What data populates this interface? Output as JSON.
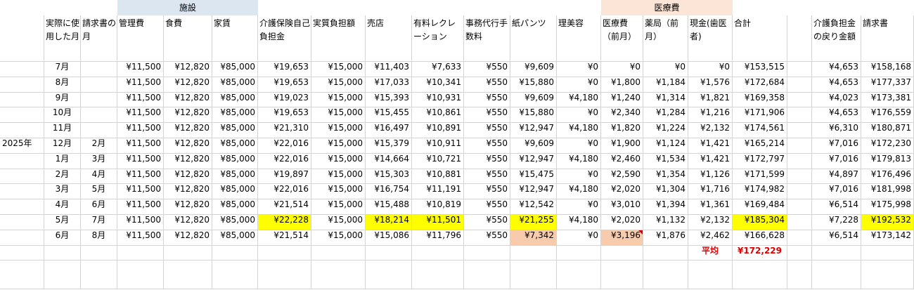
{
  "group_headers": {
    "facility": "施設",
    "medical": "医療費"
  },
  "headers": [
    "",
    "実際に使用した月",
    "請求書の月",
    "管理費",
    "食費",
    "家賃",
    "介護保険自己負担金",
    "実質負担額",
    "売店",
    "有料レクレーション",
    "事務代行手数料",
    "紙パンツ",
    "理美容",
    "医療費（前月）",
    "薬局（前月）",
    "現金(歯医者)",
    "合計",
    "",
    "介護負担金の戻り金額",
    "請求書"
  ],
  "year_label": "2025年",
  "rows": [
    {
      "used": "7月",
      "bill": "",
      "v": [
        "¥11,500",
        "¥12,820",
        "¥85,000",
        "¥19,653",
        "¥15,000",
        "¥11,403",
        "¥7,633",
        "¥550",
        "¥9,609",
        "¥0",
        "¥0",
        "¥0",
        "¥0",
        "¥153,515"
      ],
      "refund": "¥4,653",
      "invoice": "¥158,168"
    },
    {
      "used": "8月",
      "bill": "",
      "v": [
        "¥11,500",
        "¥12,820",
        "¥85,000",
        "¥19,653",
        "¥15,000",
        "¥17,033",
        "¥10,341",
        "¥550",
        "¥15,880",
        "¥0",
        "¥1,800",
        "¥1,184",
        "¥1,576",
        "¥172,684"
      ],
      "refund": "¥4,653",
      "invoice": "¥177,337"
    },
    {
      "used": "9月",
      "bill": "",
      "v": [
        "¥11,500",
        "¥12,820",
        "¥85,000",
        "¥19,023",
        "¥15,000",
        "¥15,393",
        "¥10,931",
        "¥550",
        "¥9,609",
        "¥4,180",
        "¥1,240",
        "¥1,314",
        "¥1,821",
        "¥169,358"
      ],
      "refund": "¥4,023",
      "invoice": "¥173,381"
    },
    {
      "used": "10月",
      "bill": "",
      "v": [
        "¥11,500",
        "¥12,820",
        "¥85,000",
        "¥19,653",
        "¥15,000",
        "¥15,455",
        "¥10,861",
        "¥550",
        "¥15,880",
        "¥0",
        "¥2,340",
        "¥1,284",
        "¥1,216",
        "¥171,906"
      ],
      "refund": "¥4,653",
      "invoice": "¥176,559"
    },
    {
      "used": "11月",
      "bill": "",
      "v": [
        "¥11,500",
        "¥12,820",
        "¥85,000",
        "¥21,310",
        "¥15,000",
        "¥16,497",
        "¥10,891",
        "¥550",
        "¥12,947",
        "¥4,180",
        "¥1,820",
        "¥1,224",
        "¥2,132",
        "¥174,561"
      ],
      "refund": "¥6,310",
      "invoice": "¥180,871"
    },
    {
      "used": "12月",
      "bill": "2月",
      "v": [
        "¥11,500",
        "¥12,820",
        "¥85,000",
        "¥22,016",
        "¥15,000",
        "¥15,379",
        "¥10,911",
        "¥550",
        "¥9,609",
        "¥0",
        "¥1,900",
        "¥1,124",
        "¥1,421",
        "¥165,214"
      ],
      "refund": "¥7,016",
      "invoice": "¥172,230"
    },
    {
      "used": "1月",
      "bill": "3月",
      "v": [
        "¥11,500",
        "¥12,820",
        "¥85,000",
        "¥22,016",
        "¥15,000",
        "¥14,664",
        "¥10,721",
        "¥550",
        "¥12,947",
        "¥4,180",
        "¥2,460",
        "¥1,534",
        "¥1,421",
        "¥172,797"
      ],
      "refund": "¥7,016",
      "invoice": "¥179,813"
    },
    {
      "used": "2月",
      "bill": "4月",
      "v": [
        "¥11,500",
        "¥12,820",
        "¥85,000",
        "¥19,897",
        "¥15,000",
        "¥15,303",
        "¥10,881",
        "¥550",
        "¥15,475",
        "¥0",
        "¥2,590",
        "¥1,354",
        "¥1,126",
        "¥171,599"
      ],
      "refund": "¥4,897",
      "invoice": "¥176,496"
    },
    {
      "used": "3月",
      "bill": "5月",
      "v": [
        "¥11,500",
        "¥12,820",
        "¥85,000",
        "¥22,016",
        "¥15,000",
        "¥16,754",
        "¥11,191",
        "¥550",
        "¥12,947",
        "¥4,180",
        "¥2,020",
        "¥1,304",
        "¥1,716",
        "¥174,982"
      ],
      "refund": "¥7,016",
      "invoice": "¥181,998"
    },
    {
      "used": "4月",
      "bill": "6月",
      "v": [
        "¥11,500",
        "¥12,820",
        "¥85,000",
        "¥21,514",
        "¥15,000",
        "¥15,488",
        "¥10,819",
        "¥550",
        "¥12,542",
        "¥0",
        "¥3,010",
        "¥1,394",
        "¥1,361",
        "¥169,484"
      ],
      "refund": "¥6,514",
      "invoice": "¥175,998"
    },
    {
      "used": "5月",
      "bill": "7月",
      "v": [
        "¥11,500",
        "¥12,820",
        "¥85,000",
        "¥22,228",
        "¥15,000",
        "¥18,214",
        "¥11,501",
        "¥550",
        "¥21,255",
        "¥4,180",
        "¥2,020",
        "¥1,132",
        "¥2,132",
        "¥185,304"
      ],
      "refund": "¥7,228",
      "invoice": "¥192,532"
    },
    {
      "used": "6月",
      "bill": "8月",
      "v": [
        "¥11,500",
        "¥12,820",
        "¥85,000",
        "¥21,514",
        "¥15,000",
        "¥15,086",
        "¥11,796",
        "¥550",
        "¥7,342",
        "¥0",
        "¥3,196",
        "¥1,876",
        "¥2,462",
        "¥166,628"
      ],
      "refund": "¥6,514",
      "invoice": "¥173,142"
    }
  ],
  "average": {
    "label": "平均",
    "value": "¥172,229"
  },
  "colors": {
    "facility_header": "#dce6f1",
    "medical_header": "#fce4d6",
    "highlight": "#ffff00",
    "peach": "#f8cbad",
    "average_text": "#e00000"
  }
}
